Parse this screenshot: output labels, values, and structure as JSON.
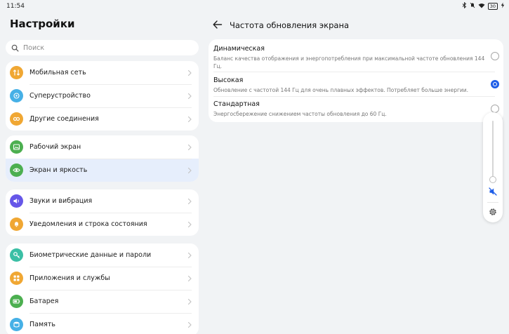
{
  "status": {
    "time": "11:54",
    "battery": "30"
  },
  "left": {
    "title": "Настройки",
    "search_placeholder": "Поиск",
    "groups": [
      [
        {
          "label": "Мобильная сеть",
          "icon": "mobile-network-icon",
          "color": "#f0a733"
        },
        {
          "label": "Суперустройство",
          "icon": "super-device-icon",
          "color": "#46b0e6"
        },
        {
          "label": "Другие соединения",
          "icon": "link-icon",
          "color": "#f0a733"
        }
      ],
      [
        {
          "label": "Рабочий экран",
          "icon": "home-screen-icon",
          "color": "#4caf50"
        },
        {
          "label": "Экран и яркость",
          "icon": "eye-icon",
          "color": "#4caf50",
          "selected": true
        }
      ],
      [
        {
          "label": "Звуки и вибрация",
          "icon": "sound-icon",
          "color": "#6657e8"
        },
        {
          "label": "Уведомления и строка состояния",
          "icon": "bell-icon",
          "color": "#f0a733"
        }
      ],
      [
        {
          "label": "Биометрические данные и пароли",
          "icon": "key-icon",
          "color": "#3bbfa5"
        },
        {
          "label": "Приложения и службы",
          "icon": "apps-icon",
          "color": "#f0a733"
        },
        {
          "label": "Батарея",
          "icon": "battery-icon",
          "color": "#4caf50"
        },
        {
          "label": "Память",
          "icon": "storage-icon",
          "color": "#46b0e6"
        }
      ]
    ]
  },
  "right": {
    "title": "Частота обновления экрана",
    "options": [
      {
        "title": "Динамическая",
        "desc": "Баланс качества отображения и энергопотребления при максимальной частоте обновления 144 Гц.",
        "selected": false
      },
      {
        "title": "Высокая",
        "desc": "Обновление с частотой 144 Гц для очень плавных эффектов. Потребляет больше энергии.",
        "selected": true
      },
      {
        "title": "Стандартная",
        "desc": "Энергосбережение снижением частоты обновления до 60 Гц.",
        "selected": false
      }
    ]
  },
  "volume": {
    "level": 0.0
  }
}
